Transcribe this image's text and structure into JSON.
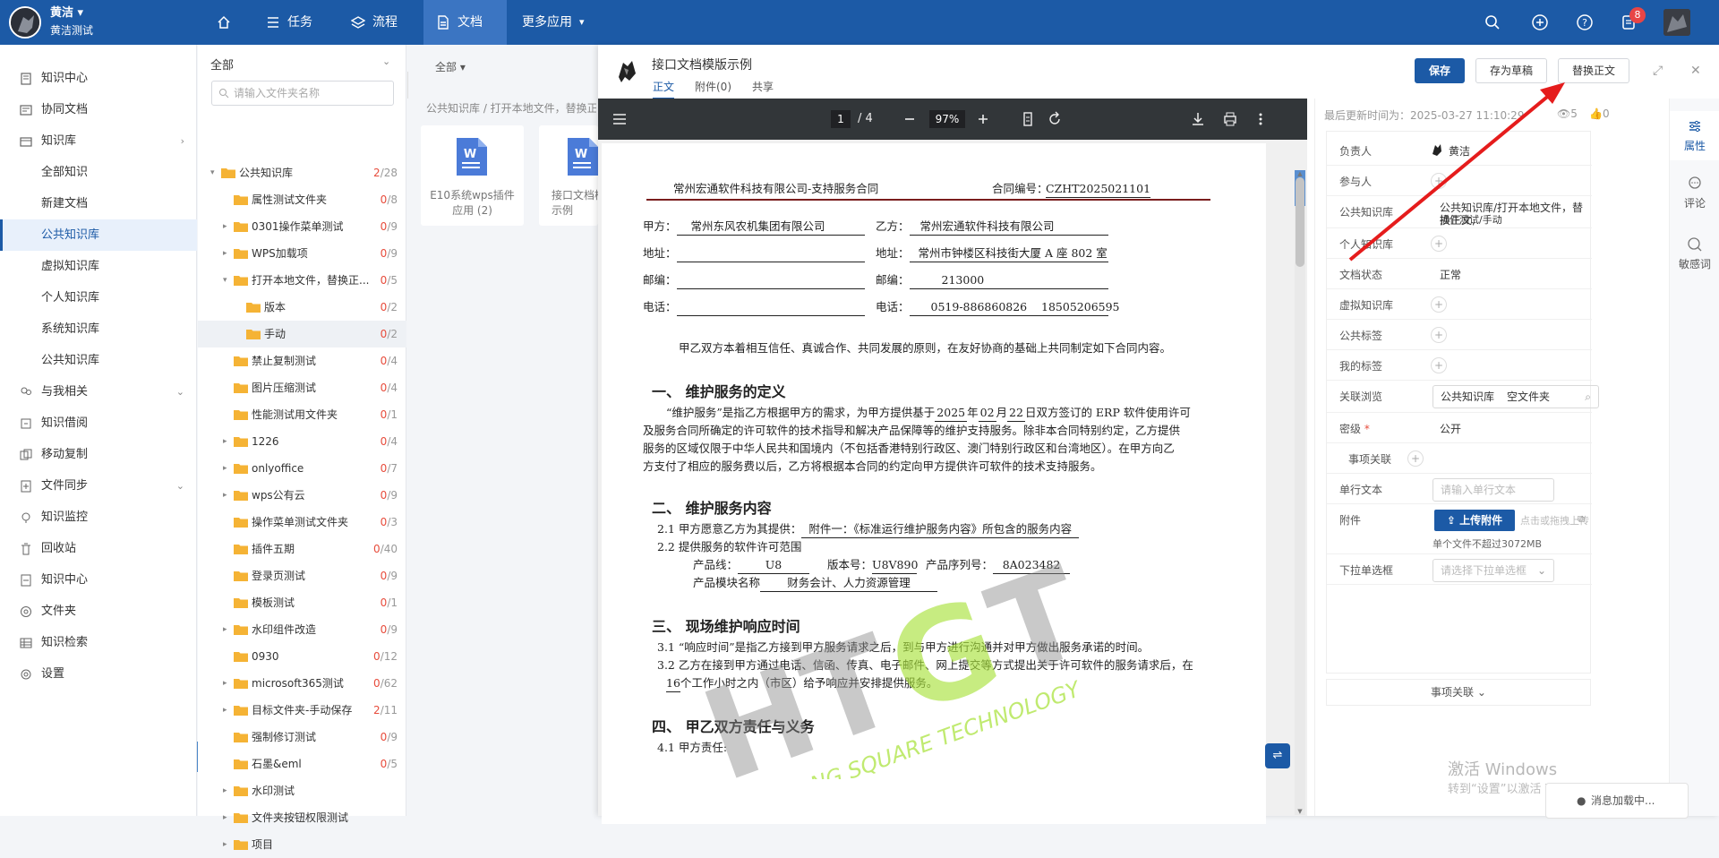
{
  "topbar": {
    "user_name": "黄洁",
    "user_org": "黄洁测试",
    "nav": [
      {
        "label": "",
        "icon": "home-icon"
      },
      {
        "label": "任务",
        "icon": "list-icon"
      },
      {
        "label": "流程",
        "icon": "layers-icon"
      },
      {
        "label": "文档",
        "icon": "document-icon"
      },
      {
        "label": "更多应用",
        "icon": "chevron-down-icon"
      }
    ],
    "notification_count": "8"
  },
  "sidebar": {
    "items": [
      {
        "label": "知识中心",
        "icon": "book-icon"
      },
      {
        "label": "协同文档",
        "icon": "doc-icon"
      },
      {
        "label": "知识库",
        "icon": "library-icon"
      },
      {
        "label": "全部知识"
      },
      {
        "label": "新建文档"
      },
      {
        "label": "公共知识库"
      },
      {
        "label": "虚拟知识库"
      },
      {
        "label": "个人知识库"
      },
      {
        "label": "系统知识库"
      },
      {
        "label": "公共知识库"
      },
      {
        "label": "与我相关",
        "icon": "users-icon"
      },
      {
        "label": "知识借阅",
        "icon": "borrow-icon"
      },
      {
        "label": "移动复制",
        "icon": "copy-icon"
      },
      {
        "label": "文件同步",
        "icon": "sync-icon"
      },
      {
        "label": "知识监控",
        "icon": "monitor-icon"
      },
      {
        "label": "回收站",
        "icon": "trash-icon"
      },
      {
        "label": "知识中心",
        "icon": "book-icon"
      },
      {
        "label": "文件夹",
        "icon": "at-icon"
      },
      {
        "label": "知识检索",
        "icon": "table-icon"
      },
      {
        "label": "设置",
        "icon": "gear-icon"
      }
    ]
  },
  "tree": {
    "header": "全部",
    "search_placeholder": "请输入文件夹名称",
    "rows": [
      {
        "name": "公共知识库",
        "a": "2",
        "b": "28"
      },
      {
        "name": "属性测试文件夹",
        "a": "0",
        "b": "8"
      },
      {
        "name": "0301操作菜单测试",
        "a": "0",
        "b": "9"
      },
      {
        "name": "WPS加载项",
        "a": "0",
        "b": "9"
      },
      {
        "name": "打开本地文件，替换正...",
        "a": "0",
        "b": "5"
      },
      {
        "name": "版本",
        "a": "0",
        "b": "2"
      },
      {
        "name": "手动",
        "a": "0",
        "b": "2"
      },
      {
        "name": "禁止复制测试",
        "a": "0",
        "b": "4"
      },
      {
        "name": "图片压缩测试",
        "a": "0",
        "b": "4"
      },
      {
        "name": "性能测试用文件夹",
        "a": "0",
        "b": "1"
      },
      {
        "name": "1226",
        "a": "0",
        "b": "4"
      },
      {
        "name": "onlyoffice",
        "a": "0",
        "b": "7"
      },
      {
        "name": "wps公有云",
        "a": "0",
        "b": "9"
      },
      {
        "name": "操作菜单测试文件夹",
        "a": "0",
        "b": "3"
      },
      {
        "name": "插件五期",
        "a": "0",
        "b": "40"
      },
      {
        "name": "登录页测试",
        "a": "0",
        "b": "9"
      },
      {
        "name": "模板测试",
        "a": "0",
        "b": "1"
      },
      {
        "name": "水印组件改造",
        "a": "0",
        "b": "9"
      },
      {
        "name": "0930",
        "a": "0",
        "b": "12"
      },
      {
        "name": "microsoft365测试",
        "a": "0",
        "b": "62"
      },
      {
        "name": "目标文件夹-手动保存",
        "a": "2",
        "b": "11"
      },
      {
        "name": "强制修订测试",
        "a": "0",
        "b": "9"
      },
      {
        "name": "石墨&eml",
        "a": "0",
        "b": "5"
      },
      {
        "name": "水印测试",
        "a": "0",
        "b": ""
      },
      {
        "name": "文件夹按钮权限测试",
        "a": "0",
        "b": ""
      },
      {
        "name": "项目",
        "a": "0",
        "b": ""
      }
    ]
  },
  "content": {
    "filter": "全部",
    "breadcrumb": "公共知识库 / 打开本地文件，替换正",
    "files": [
      {
        "name": "E10系统wps插件应用 (2)"
      },
      {
        "name": "接口文档模版示例"
      }
    ]
  },
  "detail": {
    "title": "接口文档模版示例",
    "tabs": [
      "正文",
      "附件(0)",
      "共享"
    ],
    "buttons": {
      "save": "保存",
      "draft": "存为草稿",
      "replace": "替换正文"
    },
    "viewer": {
      "page": "1",
      "total": "/ 4",
      "zoom": "97%"
    },
    "doc": {
      "header_company": "常州宏通软件科技有限公司-支持服务合同",
      "header_no_label": "合同编号：",
      "header_no": "CZHT2025021101",
      "party_a_label": "甲方：",
      "party_a": "常州东风农机集团有限公司",
      "party_b_label": "乙方：",
      "party_b": "常州宏通软件科技有限公司",
      "addr_label": "地址：",
      "addr_b": "常州市钟楼区科技街大厦 A 座 802 室",
      "post_label": "邮编：",
      "post_b": "213000",
      "tel_label": "电话：",
      "tel_b": "0519-886860826    18505206595",
      "intro": "甲乙双方本着相互信任、真诚合作、共同发展的原则，在友好协商的基础上共同制定如下合同内容。",
      "s1": "一、    维护服务的定义",
      "s1_p1a": "“维护服务”是指乙方根据甲方的需求，为甲方提供基于",
      "s1_y": "2025",
      "s1_m": "02",
      "s1_d": "22",
      "s1_p1b": "日双方签订的 ERP 软件使用许可",
      "s1_p2": "及服务合同所确定的许可软件的技术指导和解决产品保障等的维护支持服务。除非本合同特别约定，乙方提供",
      "s1_p3": "服务的区域仅限于中华人民共和国境内（不包括香港特别行政区、澳门特别行政区和台湾地区）。在甲方向乙",
      "s1_p4": "方支付了相应的服务费以后，乙方将根据本合同的约定向甲方提供许可软件的技术支持服务。",
      "s2": "二、    维护服务内容",
      "s2_p1a": "2.1  甲方愿意乙方为其提供：",
      "s2_p1b": "附件一：《标准运行维护服务内容》所包含的服务内容",
      "s2_p2": "2.2 提供服务的软件许可范围",
      "s2_p3a": "产品线：",
      "s2_p3b": "U8",
      "s2_p3c": "版本号：",
      "s2_p3d": "U8V890",
      "s2_p3e": "产品序列号：",
      "s2_p3f": "8A023482",
      "s2_p4a": "产品模块名称",
      "s2_p4b": "财务会计、人力资源管理",
      "s3": "三、    现场维护响应时间",
      "s3_p1": "3.1 “响应时间”是指乙方接到甲方服务请求之后，到与甲方进行沟通并对甲方做出服务承诺的时间。",
      "s3_p2": "3.2 乙方在接到甲方通过电话、信函、传真、电子邮件、网上提交等方式提出关于许可软件的服务请求后，在",
      "s3_p3a": "16",
      "s3_p3b": "个工作小时之内（市区）给予响应并安排提供服务。",
      "s4": "四、    甲乙双方责任与义务",
      "s4_p1": "4.1 甲方责任:",
      "watermark1": "HTGT",
      "watermark2": "HONTONG SQUARE TECHNOLOGY"
    }
  },
  "meta": {
    "updated": "最后更新时间为：2025-03-27 11:10:29",
    "views": "5",
    "likes": "0",
    "rows": [
      {
        "label": "负责人",
        "value": "黄洁"
      },
      {
        "label": "参与人",
        "value": ""
      },
      {
        "label": "公共知识库",
        "value": "公共知识库/打开本地文件，替换正文,"
      },
      {
        "label": "个人知识库",
        "value": ""
      },
      {
        "label": "文档状态",
        "value": "正常"
      },
      {
        "label": "虚拟知识库",
        "value": ""
      },
      {
        "label": "公共标签",
        "value": ""
      },
      {
        "label": "我的标签",
        "value": ""
      },
      {
        "label": "关联浏览",
        "value": ""
      },
      {
        "label": "密级",
        "value": "公开"
      },
      {
        "label": "事项关联",
        "value": ""
      },
      {
        "label": "单行文本",
        "value": ""
      },
      {
        "label": "附件",
        "value": ""
      },
      {
        "label": "下拉单选框",
        "value": ""
      }
    ],
    "pub_value_line2": "插件测试/手动",
    "related_tag1": "公共知识库",
    "related_tag2": "空文件夹",
    "single_text_placeholder": "请输入单行文本",
    "upload_label": "上传附件",
    "upload_hint": "点击或拖拽上传",
    "upload_limit": "单个文件不超过3072MB",
    "select_placeholder": "请选择下拉单选框",
    "footer": "事项关联",
    "win_activate": "激活 Windows",
    "win_activate_sub": "转到“设置”以激活 Windows。"
  },
  "rail": [
    {
      "label": "属性",
      "icon": "sliders-icon"
    },
    {
      "label": "评论",
      "icon": "comment-icon"
    },
    {
      "label": "敏感词",
      "icon": "sensitive-icon"
    }
  ],
  "toast": "消息加载中..."
}
